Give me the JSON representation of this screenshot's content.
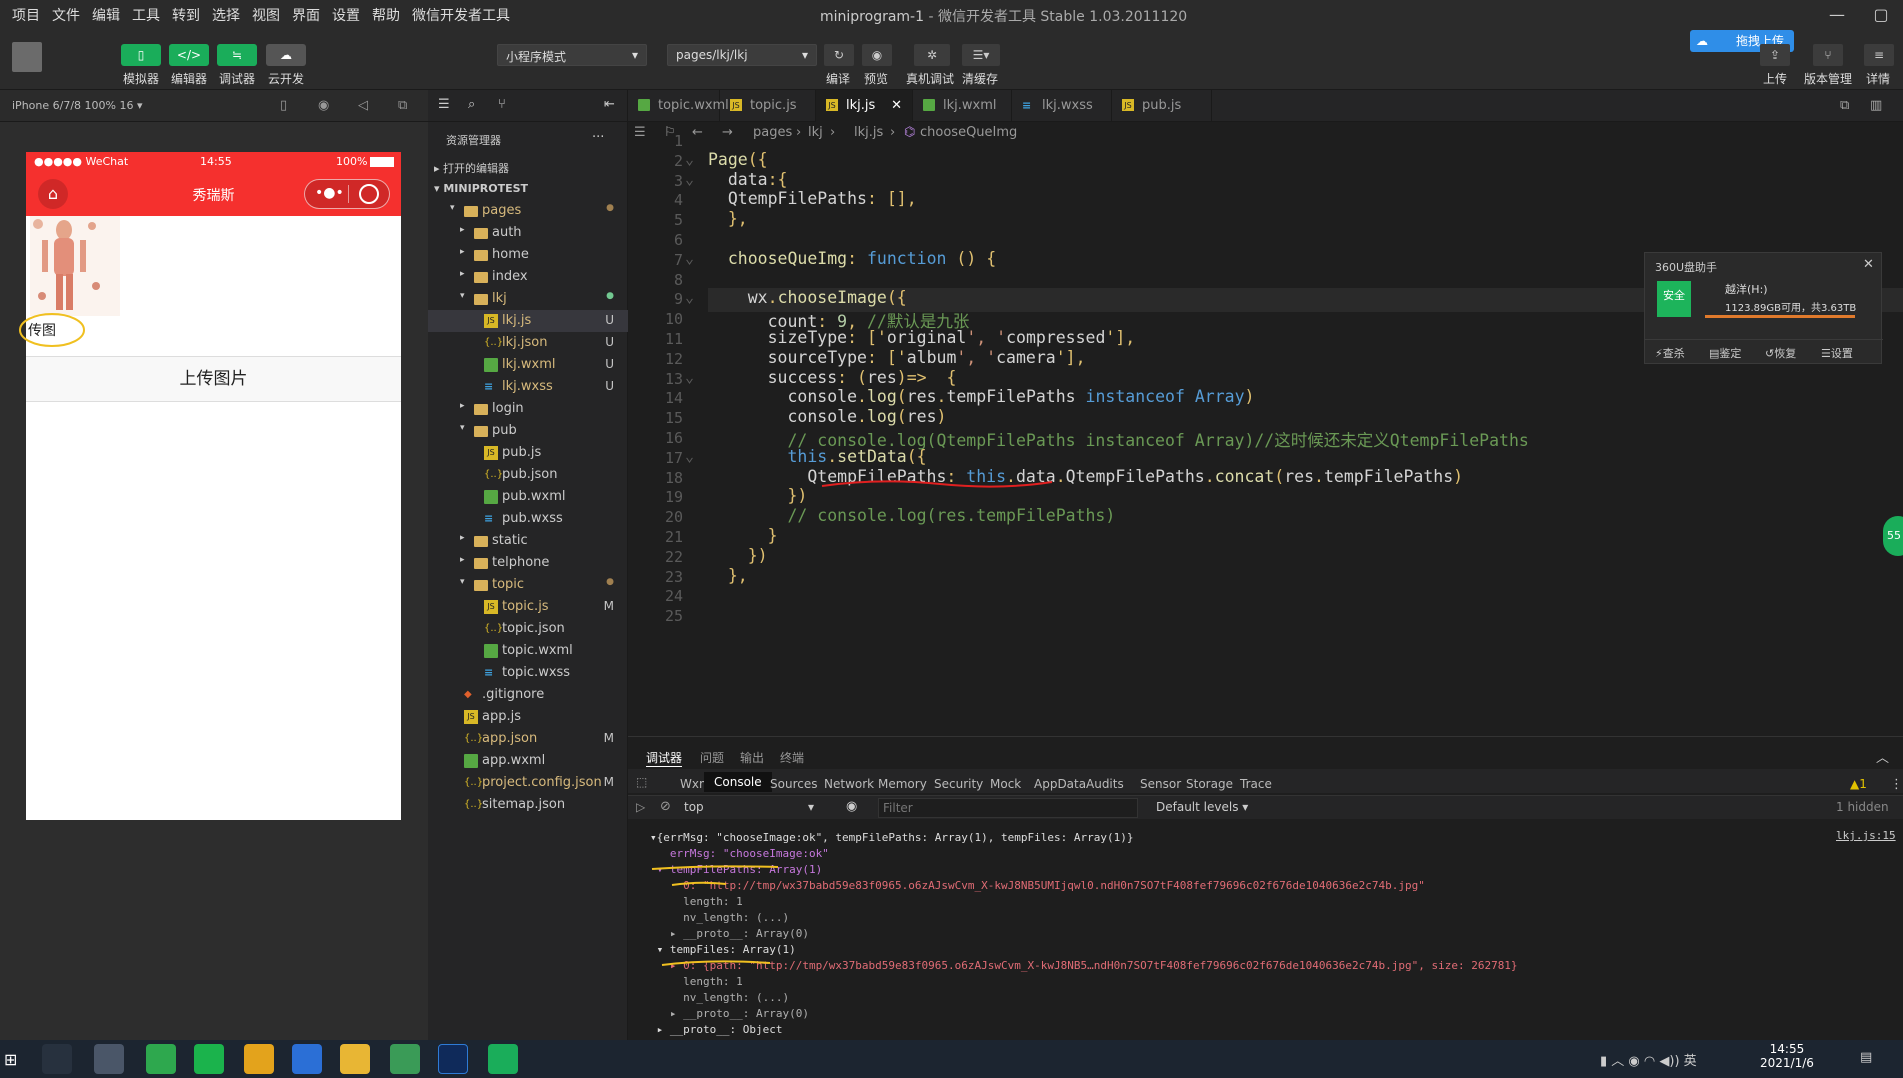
{
  "menu": [
    "项目",
    "文件",
    "编辑",
    "工具",
    "转到",
    "选择",
    "视图",
    "界面",
    "设置",
    "帮助",
    "微信开发者工具"
  ],
  "window": {
    "project": "miniprogram-1",
    "app": "- 微信开发者工具 Stable 1.03.2011120"
  },
  "toolbar": {
    "simulator": "模拟器",
    "editor": "编辑器",
    "debugger": "调试器",
    "cloud": "云开发",
    "mode": "小程序模式",
    "page": "pages/lkj/lkj",
    "compile": "编译",
    "preview": "预览",
    "realdebug": "真机调试",
    "clearcache": "清缓存",
    "upload_badge": "拖拽上传",
    "upload": "上传",
    "version": "版本管理",
    "details": "详情"
  },
  "sim": {
    "device": "iPhone 6/7/8 100% 16 ▾",
    "carrier": "●●●●● WeChat",
    "time": "14:55",
    "battery": "100%",
    "nav_title": "秀瑞斯",
    "upload_label": "传图",
    "upload_button": "上传图片"
  },
  "explorer": {
    "title": "资源管理器",
    "open_editors": "打开的编辑器",
    "project": "MINIPROTEST",
    "items": [
      {
        "name": "pages",
        "type": "folder",
        "depth": 1,
        "open": true,
        "status": "●"
      },
      {
        "name": "auth",
        "type": "folder",
        "depth": 2,
        "open": false,
        "status": ""
      },
      {
        "name": "home",
        "type": "folder",
        "depth": 2,
        "open": false,
        "status": ""
      },
      {
        "name": "index",
        "type": "folder",
        "depth": 2,
        "open": false,
        "status": ""
      },
      {
        "name": "lkj",
        "type": "folder",
        "depth": 2,
        "open": true,
        "status": "●"
      },
      {
        "name": "lkj.js",
        "type": "js",
        "depth": 3,
        "status": "U",
        "selected": true
      },
      {
        "name": "lkj.json",
        "type": "json",
        "depth": 3,
        "status": "U"
      },
      {
        "name": "lkj.wxml",
        "type": "wxml",
        "depth": 3,
        "status": "U"
      },
      {
        "name": "lkj.wxss",
        "type": "wxss",
        "depth": 3,
        "status": "U"
      },
      {
        "name": "login",
        "type": "folder",
        "depth": 2,
        "open": false,
        "status": ""
      },
      {
        "name": "pub",
        "type": "folder",
        "depth": 2,
        "open": true,
        "status": ""
      },
      {
        "name": "pub.js",
        "type": "js",
        "depth": 3,
        "status": ""
      },
      {
        "name": "pub.json",
        "type": "json",
        "depth": 3,
        "status": ""
      },
      {
        "name": "pub.wxml",
        "type": "wxml",
        "depth": 3,
        "status": ""
      },
      {
        "name": "pub.wxss",
        "type": "wxss",
        "depth": 3,
        "status": ""
      },
      {
        "name": "static",
        "type": "folder",
        "depth": 2,
        "open": false,
        "status": ""
      },
      {
        "name": "telphone",
        "type": "folder",
        "depth": 2,
        "open": false,
        "status": ""
      },
      {
        "name": "topic",
        "type": "folder",
        "depth": 2,
        "open": true,
        "status": "●"
      },
      {
        "name": "topic.js",
        "type": "js",
        "depth": 3,
        "status": "M"
      },
      {
        "name": "topic.json",
        "type": "json",
        "depth": 3,
        "status": ""
      },
      {
        "name": "topic.wxml",
        "type": "wxml",
        "depth": 3,
        "status": ""
      },
      {
        "name": "topic.wxss",
        "type": "wxss",
        "depth": 3,
        "status": ""
      },
      {
        "name": ".gitignore",
        "type": "git",
        "depth": 1,
        "status": ""
      },
      {
        "name": "app.js",
        "type": "js",
        "depth": 1,
        "status": ""
      },
      {
        "name": "app.json",
        "type": "json",
        "depth": 1,
        "status": "M"
      },
      {
        "name": "app.wxml",
        "type": "wxml",
        "depth": 1,
        "status": ""
      },
      {
        "name": "project.config.json",
        "type": "json",
        "depth": 1,
        "status": "M"
      },
      {
        "name": "sitemap.json",
        "type": "json",
        "depth": 1,
        "status": ""
      }
    ]
  },
  "tabs": [
    {
      "name": "topic.wxml",
      "type": "wxml"
    },
    {
      "name": "topic.js",
      "type": "js"
    },
    {
      "name": "lkj.js",
      "type": "js",
      "active": true
    },
    {
      "name": "lkj.wxml",
      "type": "wxml"
    },
    {
      "name": "lkj.wxss",
      "type": "wxss"
    },
    {
      "name": "pub.js",
      "type": "js"
    }
  ],
  "breadcrumb": [
    "pages",
    "lkj",
    "lkj.js",
    "chooseQueImg"
  ],
  "code_lines": [
    {
      "n": "1",
      "t": ""
    },
    {
      "n": "2",
      "t": "Page({"
    },
    {
      "n": "3",
      "t": "  data:{"
    },
    {
      "n": "4",
      "t": "  QtempFilePaths: [],"
    },
    {
      "n": "5",
      "t": "  },"
    },
    {
      "n": "6",
      "t": ""
    },
    {
      "n": "7",
      "t": "  chooseQueImg: function () {"
    },
    {
      "n": "8",
      "t": ""
    },
    {
      "n": "9",
      "t": "    wx.chooseImage({"
    },
    {
      "n": "10",
      "t": "      count: 9, //默认是九张"
    },
    {
      "n": "11",
      "t": "      sizeType: ['original', 'compressed'],"
    },
    {
      "n": "12",
      "t": "      sourceType: ['album', 'camera'],"
    },
    {
      "n": "13",
      "t": "      success: (res)=>  {"
    },
    {
      "n": "14",
      "t": "        console.log(res.tempFilePaths instanceof Array)"
    },
    {
      "n": "15",
      "t": "        console.log(res)"
    },
    {
      "n": "16",
      "t": "        // console.log(QtempFilePaths instanceof Array)//这时候还未定义QtempFilePaths"
    },
    {
      "n": "17",
      "t": "        this.setData({"
    },
    {
      "n": "18",
      "t": "          QtempFilePaths: this.data.QtempFilePaths.concat(res.tempFilePaths)"
    },
    {
      "n": "19",
      "t": "        })"
    },
    {
      "n": "20",
      "t": "        // console.log(res.tempFilePaths)"
    },
    {
      "n": "21",
      "t": "      }"
    },
    {
      "n": "22",
      "t": "    })"
    },
    {
      "n": "23",
      "t": "  },"
    },
    {
      "n": "24",
      "t": ""
    },
    {
      "n": "25",
      "t": ""
    }
  ],
  "popup360": {
    "title": "360U盘助手",
    "safe": "安全",
    "drive": "越洋(H:)",
    "info": "1123.89GB可用，共3.63TB",
    "actions": [
      "查杀",
      "鉴定",
      "恢复",
      "设置"
    ]
  },
  "panel": {
    "tabs": [
      "调试器",
      "问题",
      "输出",
      "终端"
    ],
    "devtabs": [
      "Wxml",
      "Console",
      "Sources",
      "Network",
      "Memory",
      "Security",
      "Mock",
      "AppData",
      "Audits",
      "Sensor",
      "Storage",
      "Trace"
    ],
    "warn": "▲1",
    "context": "top",
    "filter_placeholder": "Filter",
    "levels": "Default levels ▾",
    "hidden": "1 hidden",
    "source": "lkj.js:15"
  },
  "console_lines": [
    "▾{errMsg: \"chooseImage:ok\", tempFilePaths: Array(1), tempFiles: Array(1)}",
    "   errMsg: \"chooseImage:ok\"",
    " ▾ tempFilePaths: Array(1)",
    "     0: \"http://tmp/wx37babd59e83f0965.o6zAJswCvm_X-kwJ8NB5UMIjqwl0.ndH0n7SO7tF408fef79696c02f676de1040636e2c74b.jpg\"",
    "     length: 1",
    "     nv_length: (...)",
    "   ▸ __proto__: Array(0)",
    " ▾ tempFiles: Array(1)",
    "   ▸ 0: {path: \"http://tmp/wx37babd59e83f0965.o6zAJswCvm_X-kwJ8NB5…ndH0n7SO7tF408fef79696c02f676de1040636e2c74b.jpg\", size: 262781}",
    "     length: 1",
    "     nv_length: (...)",
    "   ▸ __proto__: Array(0)",
    " ▸ __proto__: Object"
  ],
  "tray": {
    "ime": "英",
    "time": "14:55",
    "date": "2021/1/6"
  }
}
